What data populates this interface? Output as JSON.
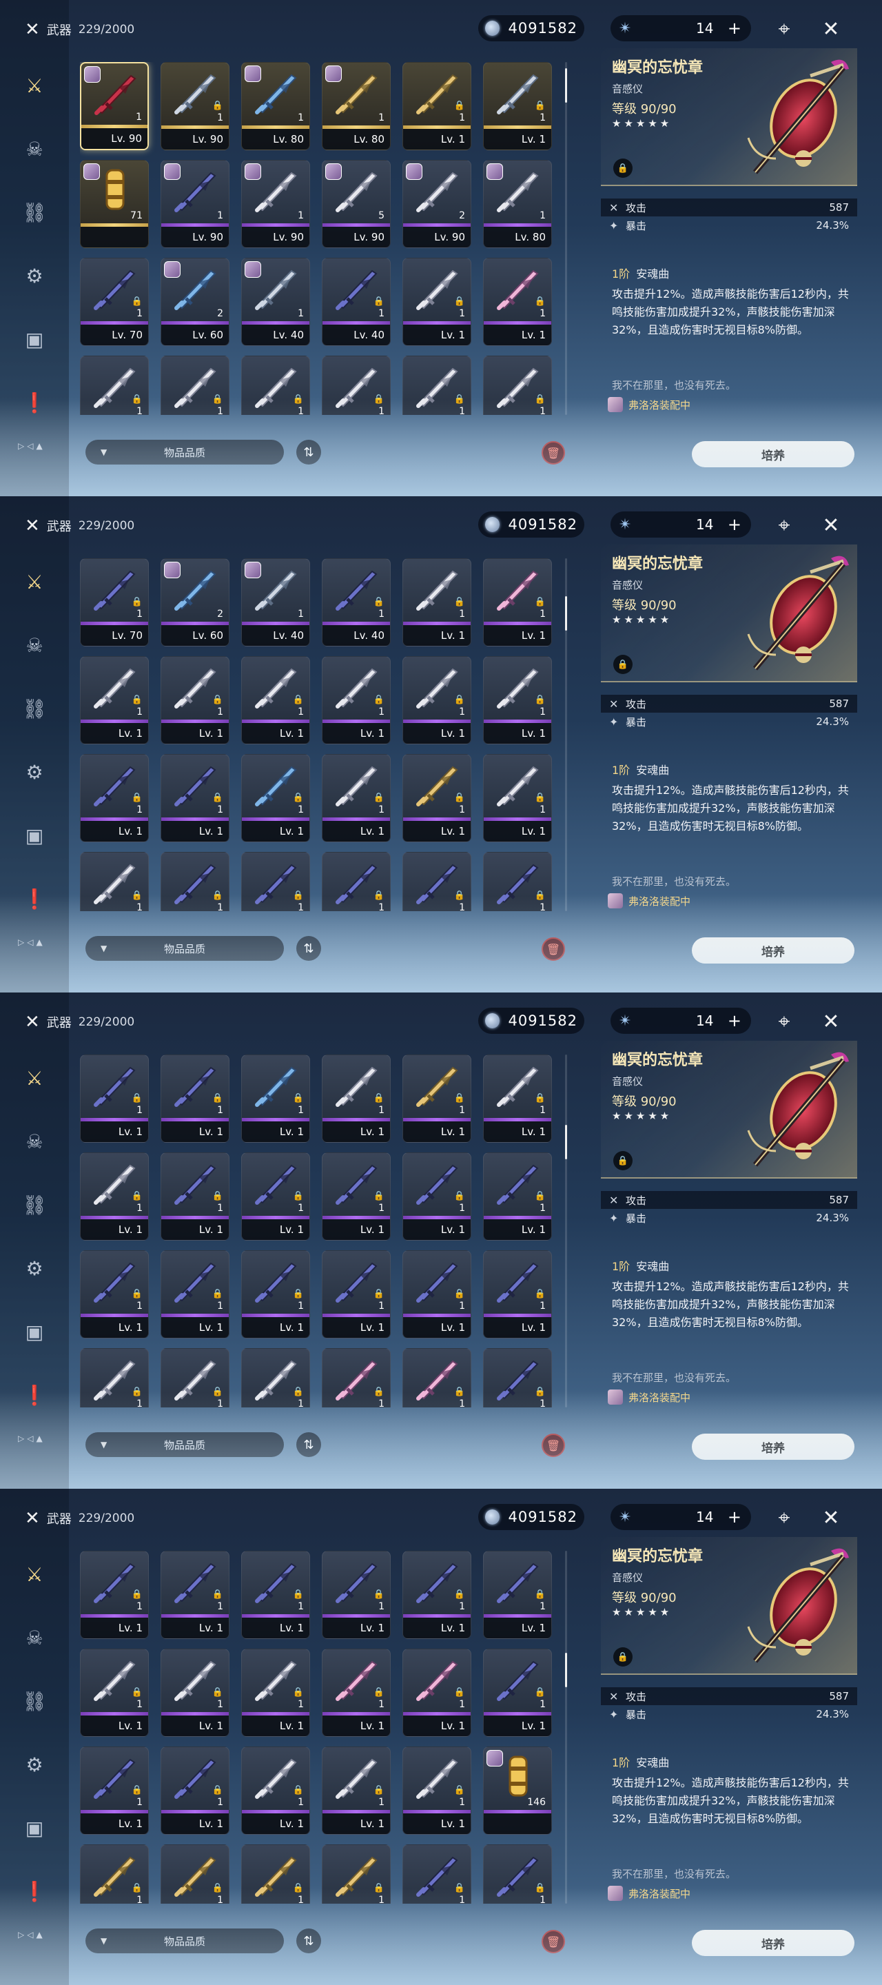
{
  "header": {
    "category_label": "武器",
    "inventory_count": "229/2000",
    "currency_value": "4091582",
    "stamina_value": "14",
    "stamina_add_label": "+"
  },
  "sidebar": {
    "items": [
      {
        "icon": "sword-cross-icon",
        "glyph": "⚔",
        "active": true
      },
      {
        "icon": "echo-mask-icon",
        "glyph": "☠",
        "active": false
      },
      {
        "icon": "chain-link-icon",
        "glyph": "⛓",
        "active": false
      },
      {
        "icon": "gear-ring-icon",
        "glyph": "⚙",
        "active": false
      },
      {
        "icon": "box-icon",
        "glyph": "▣",
        "active": false
      },
      {
        "icon": "document-alert-icon",
        "glyph": "❗",
        "active": false
      }
    ]
  },
  "bottom": {
    "mini_icons": "▷◁▲",
    "filter_label": "物品品质",
    "sort_glyph": "⇅",
    "delete_glyph": "🗑"
  },
  "detail": {
    "name": "幽冥的忘忧章",
    "type": "音感仪",
    "level_label": "等级",
    "level_value": "90/90",
    "stars": "★★★★★",
    "stat_attack_label": "攻击",
    "stat_attack_value": "587",
    "stat_crit_label": "暴击",
    "stat_crit_value": "24.3%",
    "passive_rank": "1阶",
    "passive_name": "安魂曲",
    "passive_text": "攻击提升12%。造成声骸技能伤害后12秒内，共鸣技能伤害加成提升32%，声骸技能伤害加深32%，且造成伤害时无视目标8%防御。",
    "flavor_text": "我不在那里，也没有死去。",
    "equipped_by": "弗洛洛装配中",
    "upgrade_label": "培养"
  },
  "colors": {
    "accent_gold": "#f3d68a",
    "rarity_purple": "#b06cf2",
    "rarity_gold": "#f2d57e"
  },
  "panels": [
    {
      "scroll_fraction": 0.02,
      "slots": [
        {
          "lv": "Lv. 90",
          "rank": "1",
          "q5": true,
          "owner": true,
          "selected": true,
          "lock": false,
          "art": "red"
        },
        {
          "lv": "Lv. 90",
          "rank": "1",
          "q5": true,
          "owner": false,
          "lock": true,
          "art": "blade"
        },
        {
          "lv": "Lv. 80",
          "rank": "1",
          "q5": true,
          "owner": true,
          "lock": false,
          "art": "blue"
        },
        {
          "lv": "Lv. 80",
          "rank": "1",
          "q5": true,
          "owner": true,
          "lock": false,
          "art": "gold"
        },
        {
          "lv": "Lv. 1",
          "rank": "1",
          "q5": true,
          "owner": false,
          "lock": true,
          "art": "gold"
        },
        {
          "lv": "Lv. 1",
          "rank": "1",
          "q5": true,
          "owner": false,
          "lock": true,
          "art": "blade"
        },
        {
          "lv": "",
          "rank": "71",
          "q5": true,
          "owner": true,
          "lock": false,
          "art": "tube"
        },
        {
          "lv": "Lv. 90",
          "rank": "1",
          "q5": false,
          "owner": true,
          "lock": false,
          "art": "dark"
        },
        {
          "lv": "Lv. 90",
          "rank": "1",
          "q5": false,
          "owner": true,
          "lock": false,
          "art": "white"
        },
        {
          "lv": "Lv. 90",
          "rank": "5",
          "q5": false,
          "owner": true,
          "lock": false,
          "art": "white"
        },
        {
          "lv": "Lv. 90",
          "rank": "2",
          "q5": false,
          "owner": true,
          "lock": false,
          "art": "white"
        },
        {
          "lv": "Lv. 80",
          "rank": "1",
          "q5": false,
          "owner": true,
          "lock": false,
          "art": "white"
        },
        {
          "lv": "Lv. 70",
          "rank": "1",
          "q5": false,
          "owner": false,
          "lock": true,
          "art": "dark"
        },
        {
          "lv": "Lv. 60",
          "rank": "2",
          "q5": false,
          "owner": true,
          "lock": false,
          "art": "blue"
        },
        {
          "lv": "Lv. 40",
          "rank": "1",
          "q5": false,
          "owner": true,
          "lock": false,
          "art": "blade"
        },
        {
          "lv": "Lv. 40",
          "rank": "1",
          "q5": false,
          "owner": false,
          "lock": true,
          "art": "dark"
        },
        {
          "lv": "Lv. 1",
          "rank": "1",
          "q5": false,
          "owner": false,
          "lock": true,
          "art": "white"
        },
        {
          "lv": "Lv. 1",
          "rank": "1",
          "q5": false,
          "owner": false,
          "lock": true,
          "art": "pink"
        },
        {
          "lv": "",
          "rank": "1",
          "q5": false,
          "owner": false,
          "lock": true,
          "art": "white"
        },
        {
          "lv": "",
          "rank": "1",
          "q5": false,
          "owner": false,
          "lock": true,
          "art": "white"
        },
        {
          "lv": "",
          "rank": "1",
          "q5": false,
          "owner": false,
          "lock": true,
          "art": "white"
        },
        {
          "lv": "",
          "rank": "1",
          "q5": false,
          "owner": false,
          "lock": true,
          "art": "white"
        },
        {
          "lv": "",
          "rank": "1",
          "q5": false,
          "owner": false,
          "lock": true,
          "art": "white"
        },
        {
          "lv": "",
          "rank": "1",
          "q5": false,
          "owner": false,
          "lock": true,
          "art": "white"
        }
      ]
    },
    {
      "scroll_fraction": 0.12,
      "slots": [
        {
          "lv": "Lv. 70",
          "rank": "1",
          "q5": false,
          "owner": false,
          "lock": true,
          "art": "dark"
        },
        {
          "lv": "Lv. 60",
          "rank": "2",
          "q5": false,
          "owner": true,
          "lock": false,
          "art": "blue"
        },
        {
          "lv": "Lv. 40",
          "rank": "1",
          "q5": false,
          "owner": true,
          "lock": false,
          "art": "blade"
        },
        {
          "lv": "Lv. 40",
          "rank": "1",
          "q5": false,
          "owner": false,
          "lock": true,
          "art": "dark"
        },
        {
          "lv": "Lv. 1",
          "rank": "1",
          "q5": false,
          "owner": false,
          "lock": true,
          "art": "white"
        },
        {
          "lv": "Lv. 1",
          "rank": "1",
          "q5": false,
          "owner": false,
          "lock": true,
          "art": "pink"
        },
        {
          "lv": "Lv. 1",
          "rank": "1",
          "q5": false,
          "owner": false,
          "lock": true,
          "art": "white"
        },
        {
          "lv": "Lv. 1",
          "rank": "1",
          "q5": false,
          "owner": false,
          "lock": true,
          "art": "white"
        },
        {
          "lv": "Lv. 1",
          "rank": "1",
          "q5": false,
          "owner": false,
          "lock": true,
          "art": "white"
        },
        {
          "lv": "Lv. 1",
          "rank": "1",
          "q5": false,
          "owner": false,
          "lock": true,
          "art": "white"
        },
        {
          "lv": "Lv. 1",
          "rank": "1",
          "q5": false,
          "owner": false,
          "lock": true,
          "art": "white"
        },
        {
          "lv": "Lv. 1",
          "rank": "1",
          "q5": false,
          "owner": false,
          "lock": true,
          "art": "white"
        },
        {
          "lv": "Lv. 1",
          "rank": "1",
          "q5": false,
          "owner": false,
          "lock": true,
          "art": "dark"
        },
        {
          "lv": "Lv. 1",
          "rank": "1",
          "q5": false,
          "owner": false,
          "lock": true,
          "art": "dark"
        },
        {
          "lv": "Lv. 1",
          "rank": "1",
          "q5": false,
          "owner": false,
          "lock": true,
          "art": "blue"
        },
        {
          "lv": "Lv. 1",
          "rank": "1",
          "q5": false,
          "owner": false,
          "lock": true,
          "art": "white"
        },
        {
          "lv": "Lv. 1",
          "rank": "1",
          "q5": false,
          "owner": false,
          "lock": true,
          "art": "gold"
        },
        {
          "lv": "Lv. 1",
          "rank": "1",
          "q5": false,
          "owner": false,
          "lock": true,
          "art": "white"
        },
        {
          "lv": "",
          "rank": "1",
          "q5": false,
          "owner": false,
          "lock": true,
          "art": "white"
        },
        {
          "lv": "",
          "rank": "1",
          "q5": false,
          "owner": false,
          "lock": true,
          "art": "dark"
        },
        {
          "lv": "",
          "rank": "1",
          "q5": false,
          "owner": false,
          "lock": true,
          "art": "dark"
        },
        {
          "lv": "",
          "rank": "1",
          "q5": false,
          "owner": false,
          "lock": true,
          "art": "dark"
        },
        {
          "lv": "",
          "rank": "1",
          "q5": false,
          "owner": false,
          "lock": true,
          "art": "dark"
        },
        {
          "lv": "",
          "rank": "1",
          "q5": false,
          "owner": false,
          "lock": true,
          "art": "dark"
        }
      ]
    },
    {
      "scroll_fraction": 0.22,
      "slots": [
        {
          "lv": "Lv. 1",
          "rank": "1",
          "q5": false,
          "owner": false,
          "lock": true,
          "art": "dark"
        },
        {
          "lv": "Lv. 1",
          "rank": "1",
          "q5": false,
          "owner": false,
          "lock": true,
          "art": "dark"
        },
        {
          "lv": "Lv. 1",
          "rank": "1",
          "q5": false,
          "owner": false,
          "lock": true,
          "art": "blue"
        },
        {
          "lv": "Lv. 1",
          "rank": "1",
          "q5": false,
          "owner": false,
          "lock": true,
          "art": "white"
        },
        {
          "lv": "Lv. 1",
          "rank": "1",
          "q5": false,
          "owner": false,
          "lock": true,
          "art": "gold"
        },
        {
          "lv": "Lv. 1",
          "rank": "1",
          "q5": false,
          "owner": false,
          "lock": true,
          "art": "white"
        },
        {
          "lv": "Lv. 1",
          "rank": "1",
          "q5": false,
          "owner": false,
          "lock": true,
          "art": "white"
        },
        {
          "lv": "Lv. 1",
          "rank": "1",
          "q5": false,
          "owner": false,
          "lock": true,
          "art": "dark"
        },
        {
          "lv": "Lv. 1",
          "rank": "1",
          "q5": false,
          "owner": false,
          "lock": true,
          "art": "dark"
        },
        {
          "lv": "Lv. 1",
          "rank": "1",
          "q5": false,
          "owner": false,
          "lock": true,
          "art": "dark"
        },
        {
          "lv": "Lv. 1",
          "rank": "1",
          "q5": false,
          "owner": false,
          "lock": true,
          "art": "dark"
        },
        {
          "lv": "Lv. 1",
          "rank": "1",
          "q5": false,
          "owner": false,
          "lock": true,
          "art": "dark"
        },
        {
          "lv": "Lv. 1",
          "rank": "1",
          "q5": false,
          "owner": false,
          "lock": true,
          "art": "dark"
        },
        {
          "lv": "Lv. 1",
          "rank": "1",
          "q5": false,
          "owner": false,
          "lock": true,
          "art": "dark"
        },
        {
          "lv": "Lv. 1",
          "rank": "1",
          "q5": false,
          "owner": false,
          "lock": true,
          "art": "dark"
        },
        {
          "lv": "Lv. 1",
          "rank": "1",
          "q5": false,
          "owner": false,
          "lock": true,
          "art": "dark"
        },
        {
          "lv": "Lv. 1",
          "rank": "1",
          "q5": false,
          "owner": false,
          "lock": true,
          "art": "dark"
        },
        {
          "lv": "Lv. 1",
          "rank": "1",
          "q5": false,
          "owner": false,
          "lock": true,
          "art": "dark"
        },
        {
          "lv": "",
          "rank": "1",
          "q5": false,
          "owner": false,
          "lock": true,
          "art": "white"
        },
        {
          "lv": "",
          "rank": "1",
          "q5": false,
          "owner": false,
          "lock": true,
          "art": "white"
        },
        {
          "lv": "",
          "rank": "1",
          "q5": false,
          "owner": false,
          "lock": true,
          "art": "white"
        },
        {
          "lv": "",
          "rank": "1",
          "q5": false,
          "owner": false,
          "lock": true,
          "art": "pink"
        },
        {
          "lv": "",
          "rank": "1",
          "q5": false,
          "owner": false,
          "lock": true,
          "art": "pink"
        },
        {
          "lv": "",
          "rank": "1",
          "q5": false,
          "owner": false,
          "lock": true,
          "art": "dark"
        }
      ]
    },
    {
      "scroll_fraction": 0.32,
      "slots": [
        {
          "lv": "Lv. 1",
          "rank": "1",
          "q5": false,
          "owner": false,
          "lock": true,
          "art": "dark"
        },
        {
          "lv": "Lv. 1",
          "rank": "1",
          "q5": false,
          "owner": false,
          "lock": true,
          "art": "dark"
        },
        {
          "lv": "Lv. 1",
          "rank": "1",
          "q5": false,
          "owner": false,
          "lock": true,
          "art": "dark"
        },
        {
          "lv": "Lv. 1",
          "rank": "1",
          "q5": false,
          "owner": false,
          "lock": true,
          "art": "dark"
        },
        {
          "lv": "Lv. 1",
          "rank": "1",
          "q5": false,
          "owner": false,
          "lock": true,
          "art": "dark"
        },
        {
          "lv": "Lv. 1",
          "rank": "1",
          "q5": false,
          "owner": false,
          "lock": true,
          "art": "dark"
        },
        {
          "lv": "Lv. 1",
          "rank": "1",
          "q5": false,
          "owner": false,
          "lock": true,
          "art": "white"
        },
        {
          "lv": "Lv. 1",
          "rank": "1",
          "q5": false,
          "owner": false,
          "lock": true,
          "art": "white"
        },
        {
          "lv": "Lv. 1",
          "rank": "1",
          "q5": false,
          "owner": false,
          "lock": true,
          "art": "white"
        },
        {
          "lv": "Lv. 1",
          "rank": "1",
          "q5": false,
          "owner": false,
          "lock": true,
          "art": "pink"
        },
        {
          "lv": "Lv. 1",
          "rank": "1",
          "q5": false,
          "owner": false,
          "lock": true,
          "art": "pink"
        },
        {
          "lv": "Lv. 1",
          "rank": "1",
          "q5": false,
          "owner": false,
          "lock": true,
          "art": "dark"
        },
        {
          "lv": "Lv. 1",
          "rank": "1",
          "q5": false,
          "owner": false,
          "lock": true,
          "art": "dark"
        },
        {
          "lv": "Lv. 1",
          "rank": "1",
          "q5": false,
          "owner": false,
          "lock": true,
          "art": "dark"
        },
        {
          "lv": "Lv. 1",
          "rank": "1",
          "q5": false,
          "owner": false,
          "lock": true,
          "art": "white"
        },
        {
          "lv": "Lv. 1",
          "rank": "1",
          "q5": false,
          "owner": false,
          "lock": true,
          "art": "white"
        },
        {
          "lv": "Lv. 1",
          "rank": "1",
          "q5": false,
          "owner": false,
          "lock": true,
          "art": "white"
        },
        {
          "lv": "",
          "rank": "146",
          "q5": false,
          "owner": true,
          "lock": false,
          "art": "tube"
        },
        {
          "lv": "",
          "rank": "1",
          "q5": false,
          "owner": false,
          "lock": true,
          "art": "gold"
        },
        {
          "lv": "",
          "rank": "1",
          "q5": false,
          "owner": false,
          "lock": true,
          "art": "gold"
        },
        {
          "lv": "",
          "rank": "1",
          "q5": false,
          "owner": false,
          "lock": true,
          "art": "gold"
        },
        {
          "lv": "",
          "rank": "1",
          "q5": false,
          "owner": false,
          "lock": true,
          "art": "gold"
        },
        {
          "lv": "",
          "rank": "1",
          "q5": false,
          "owner": false,
          "lock": true,
          "art": "dark"
        },
        {
          "lv": "",
          "rank": "1",
          "q5": false,
          "owner": false,
          "lock": true,
          "art": "dark"
        }
      ]
    }
  ]
}
